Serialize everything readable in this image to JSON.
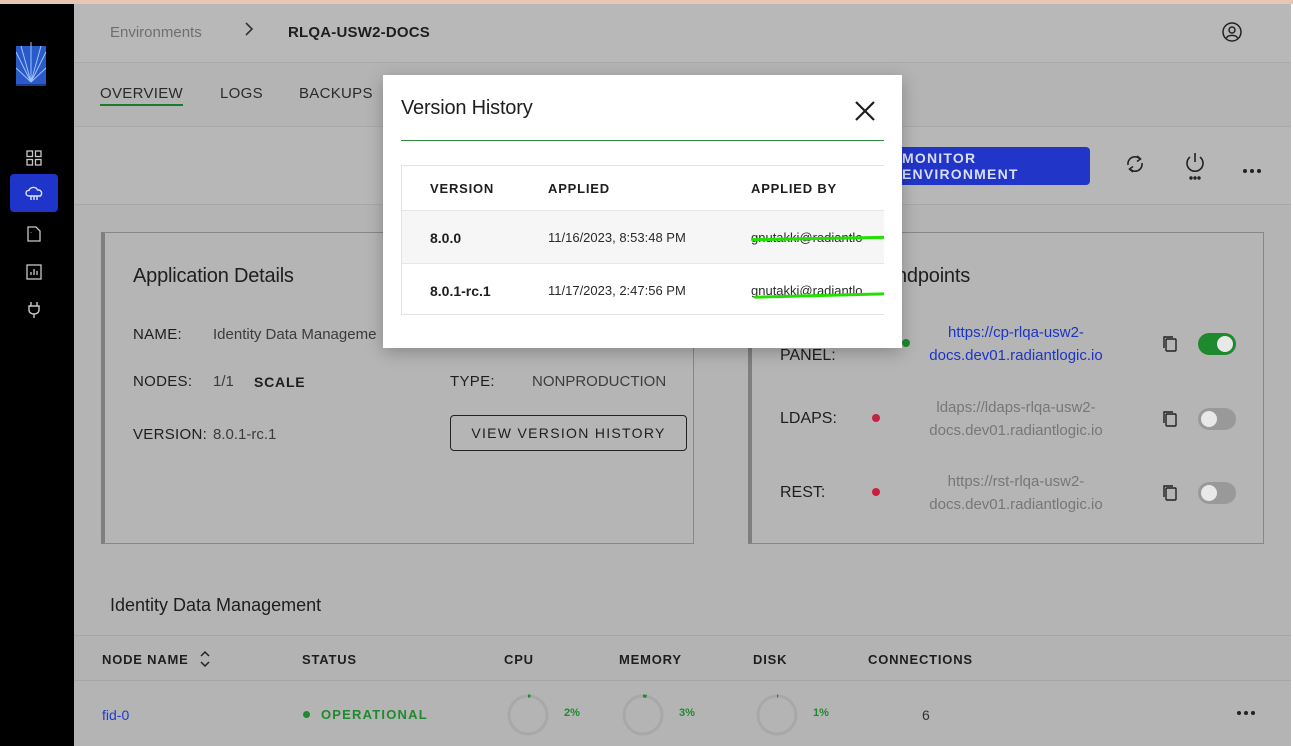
{
  "header": {
    "breadcrumb_root": "Environments",
    "breadcrumb_current": "RLQA-USW2-DOCS"
  },
  "sidebar": {
    "items": [
      {
        "icon": "dashboard-icon"
      },
      {
        "icon": "cloud-icon",
        "active": true
      },
      {
        "icon": "file-icon"
      },
      {
        "icon": "chart-icon"
      },
      {
        "icon": "plug-icon"
      }
    ]
  },
  "tabs": [
    {
      "label": "OVERVIEW",
      "active": true
    },
    {
      "label": "LOGS"
    },
    {
      "label": "BACKUPS"
    }
  ],
  "toolbar": {
    "monitor_label": "MONITOR ENVIRONMENT"
  },
  "app_details": {
    "title": "Application Details",
    "name_label": "NAME:",
    "name_value": "Identity Data Manageme",
    "nodes_label": "NODES:",
    "nodes_value": "1/1",
    "scale_label": "SCALE",
    "type_label": "TYPE:",
    "type_value": "NONPRODUCTION",
    "version_label": "VERSION:",
    "version_value": "8.0.1-rc.1",
    "history_button": "VIEW VERSION HISTORY"
  },
  "endpoints": {
    "title_visible": "ndpoints",
    "panel": {
      "label": "PANEL:",
      "line1": "https://cp-rlqa-usw2-",
      "line2": "docs.dev01.radiantlogic.io",
      "enabled": true
    },
    "ldaps": {
      "label": "LDAPS:",
      "line1": "ldaps://ldaps-rlqa-usw2-",
      "line2": "docs.dev01.radiantlogic.io",
      "enabled": false
    },
    "rest": {
      "label": "REST:",
      "line1": "https://rst-rlqa-usw2-",
      "line2": "docs.dev01.radiantlogic.io",
      "enabled": false
    }
  },
  "nodes_section": {
    "title": "Identity Data Management",
    "columns": [
      "NODE NAME",
      "STATUS",
      "CPU",
      "MEMORY",
      "DISK",
      "CONNECTIONS"
    ],
    "rows": [
      {
        "name": "fid-0",
        "status": "OPERATIONAL",
        "cpu": "2%",
        "memory": "3%",
        "disk": "1%",
        "connections": "6"
      }
    ]
  },
  "modal": {
    "title": "Version History",
    "columns": [
      "VERSION",
      "APPLIED",
      "APPLIED BY"
    ],
    "rows": [
      {
        "version": "8.0.0",
        "applied": "11/16/2023, 8:53:48 PM",
        "applied_by": "gnutakki@radiantlo"
      },
      {
        "version": "8.0.1-rc.1",
        "applied": "11/17/2023, 2:47:56 PM",
        "applied_by": "gnutakki@radiantlo"
      }
    ]
  },
  "colors": {
    "accent": "#2136c8",
    "success": "#1e8a2d",
    "danger": "#c8203f",
    "redaction": "#22e000"
  }
}
